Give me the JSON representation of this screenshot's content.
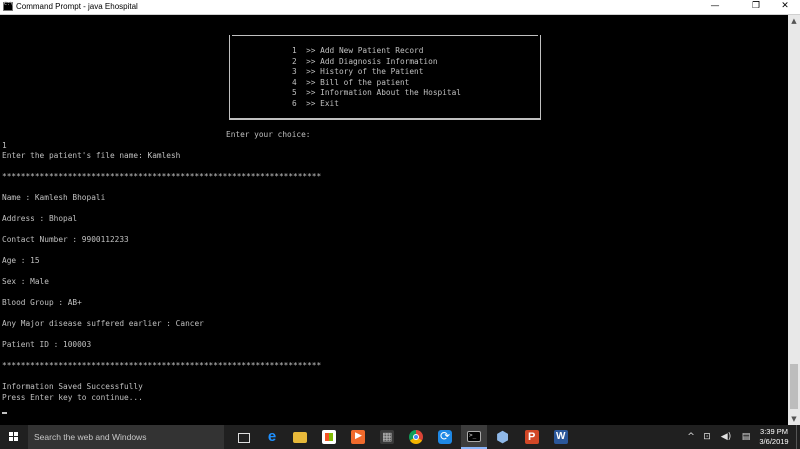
{
  "window": {
    "title": "Command Prompt - java  Ehospital",
    "minimize": "—",
    "maximize": "❐",
    "close": "✕"
  },
  "menu": {
    "items": [
      "1  >> Add New Patient Record",
      "2  >> Add Diagnosis Information",
      "3  >> History of the Patient",
      "4  >> Bill of the patient",
      "5  >> Information About the Hospital",
      "6  >> Exit"
    ]
  },
  "console": {
    "prompt": "Enter your choice:",
    "choice_input": "1",
    "file_prompt": "Enter the patient's file name: Kamlesh",
    "separator": "********************************************************************",
    "name": "Name : Kamlesh Bhopali",
    "address": "Address : Bhopal",
    "contact": "Contact Number : 9900112233",
    "age": "Age : 15",
    "sex": "Sex : Male",
    "blood_group": "Blood Group : AB+",
    "disease": "Any Major disease suffered earlier : Cancer",
    "patient_id": "Patient ID : 100003",
    "separator2": "********************************************************************",
    "saved_msg": "Information Saved Successfully",
    "continue_msg": "Press Enter key to continue..."
  },
  "taskbar": {
    "search_placeholder": "Search the web and Windows",
    "tray": {
      "chevron": "^",
      "network": "⊡",
      "volume": "◀)",
      "notifications": "▤"
    },
    "clock": {
      "time": "3:39 PM",
      "date": "3/6/2019"
    }
  }
}
